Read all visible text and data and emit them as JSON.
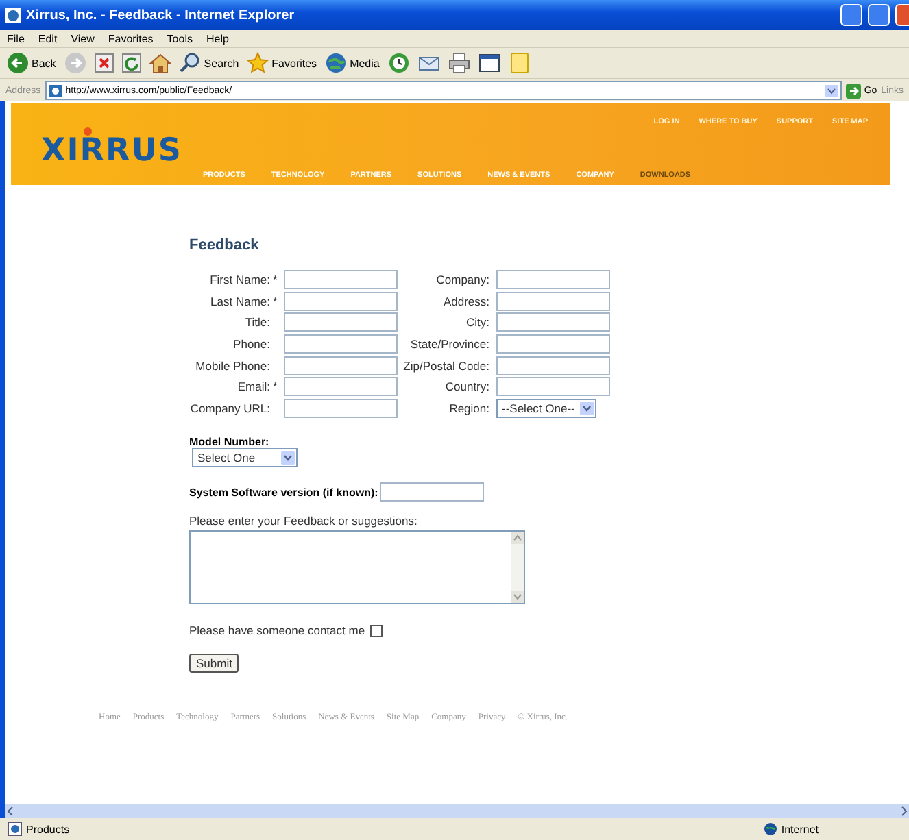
{
  "window": {
    "title": "Xirrus, Inc. - Feedback - Internet Explorer"
  },
  "menu": [
    "File",
    "Edit",
    "View",
    "Favorites",
    "Tools",
    "Help"
  ],
  "toolbar": [
    {
      "kind": "back",
      "label": "Back"
    },
    {
      "kind": "forward"
    },
    {
      "kind": "stop"
    },
    {
      "kind": "refresh"
    },
    {
      "kind": "home"
    },
    {
      "kind": "search",
      "label": "Search"
    },
    {
      "kind": "favorites",
      "label": "Favorites"
    },
    {
      "kind": "media",
      "label": "Media"
    },
    {
      "kind": "history"
    },
    {
      "kind": "mail"
    },
    {
      "kind": "print"
    },
    {
      "kind": "edit"
    },
    {
      "kind": "note"
    }
  ],
  "address": {
    "label": "Address",
    "value": "http://www.xirrus.com/public/Feedback/",
    "go": "Go",
    "links": "Links"
  },
  "site": {
    "logo": "XIRRUS",
    "top_nav": [
      "LOG IN",
      "WHERE TO BUY",
      "SUPPORT",
      "SITE MAP"
    ],
    "main_nav": [
      "PRODUCTS",
      "TECHNOLOGY",
      "PARTNERS",
      "SOLUTIONS",
      "NEWS & EVENTS",
      "COMPANY",
      "DOWNLOADS"
    ]
  },
  "form": {
    "heading": "Feedback",
    "left_fields": [
      {
        "label": "First Name:",
        "marker": "*"
      },
      {
        "label": "Last Name:",
        "marker": "*"
      },
      {
        "label": "Title:"
      },
      {
        "label": "Phone:"
      },
      {
        "label": "Mobile Phone:"
      },
      {
        "label": "Email:",
        "marker": "*"
      },
      {
        "label": "Company URL:"
      }
    ],
    "right_fields": [
      {
        "label": "Company:",
        "kind": "text"
      },
      {
        "label": "Address:",
        "kind": "text"
      },
      {
        "label": "City:",
        "kind": "text"
      },
      {
        "label": "State/Province:",
        "kind": "text"
      },
      {
        "label": "Zip/Postal Code:",
        "kind": "text"
      },
      {
        "label": "Country:",
        "kind": "text"
      },
      {
        "label": "Region:",
        "kind": "select",
        "value": "--Select One--"
      }
    ],
    "model": {
      "label": "Model Number:",
      "value": "Select One"
    },
    "software": {
      "label": "System Software version (if known):"
    },
    "feedback": {
      "label": "Please enter your Feedback or suggestions:"
    },
    "contact": {
      "label": "Please have someone contact me",
      "checked": false
    },
    "submit": "Submit"
  },
  "footer": [
    "Home",
    "Products",
    "Technology",
    "Partners",
    "Solutions",
    "News & Events",
    "Site Map",
    "Company",
    "Privacy",
    "© Xirrus, Inc."
  ],
  "status": {
    "text": "Products",
    "zone": "Internet"
  }
}
